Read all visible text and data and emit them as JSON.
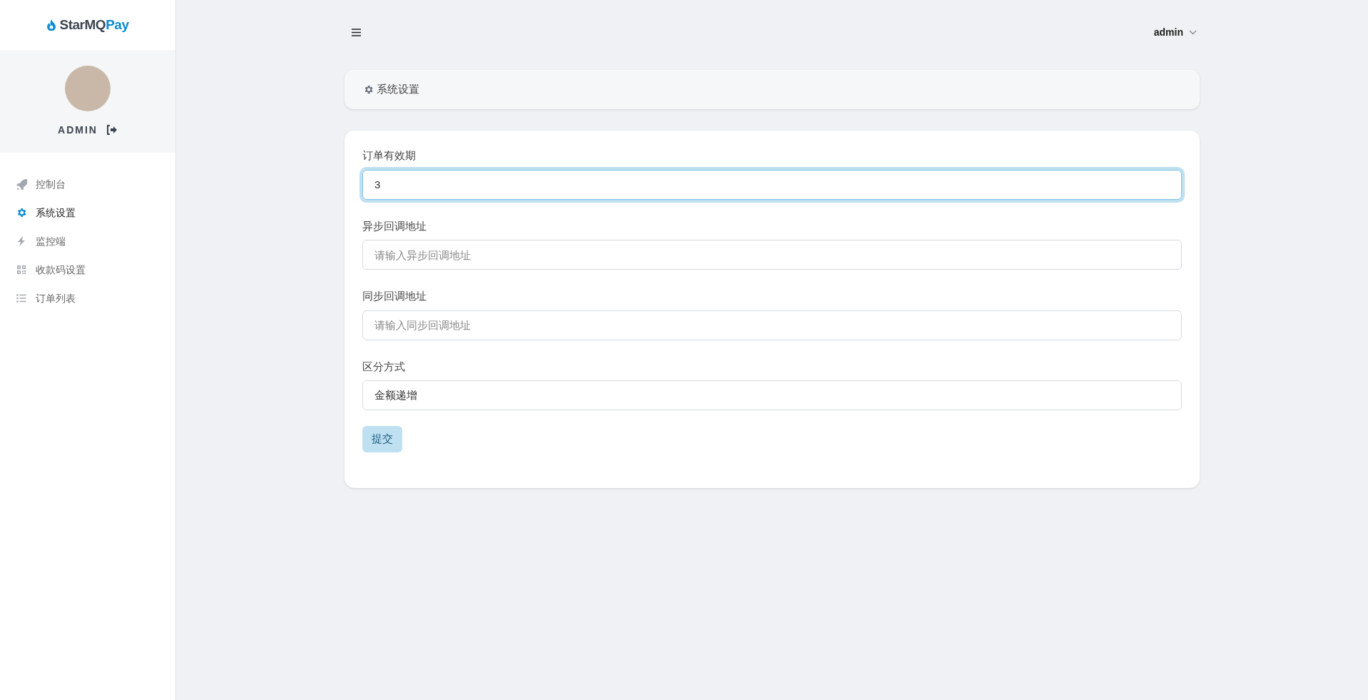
{
  "brand": {
    "name": "StarMQ",
    "accent": "Pay"
  },
  "profile": {
    "username": "ADMIN"
  },
  "sidebar": {
    "items": [
      {
        "label": "控制台",
        "selected": false
      },
      {
        "label": "系统设置",
        "selected": true
      },
      {
        "label": "监控端",
        "selected": false
      },
      {
        "label": "收款码设置",
        "selected": false
      },
      {
        "label": "订单列表",
        "selected": false
      }
    ]
  },
  "topbar": {
    "user": "admin"
  },
  "breadcrumb": {
    "title": "系统设置"
  },
  "form": {
    "fields": [
      {
        "label": "订单有效期",
        "value": "3",
        "focused": true
      },
      {
        "label": "异步回调地址",
        "placeholder": "请输入异步回调地址",
        "focused": false
      },
      {
        "label": "同步回调地址",
        "placeholder": "请输入同步回调地址",
        "focused": false
      },
      {
        "label": "区分方式",
        "value": "金额递增",
        "focused": false
      }
    ],
    "submit": "提交"
  }
}
